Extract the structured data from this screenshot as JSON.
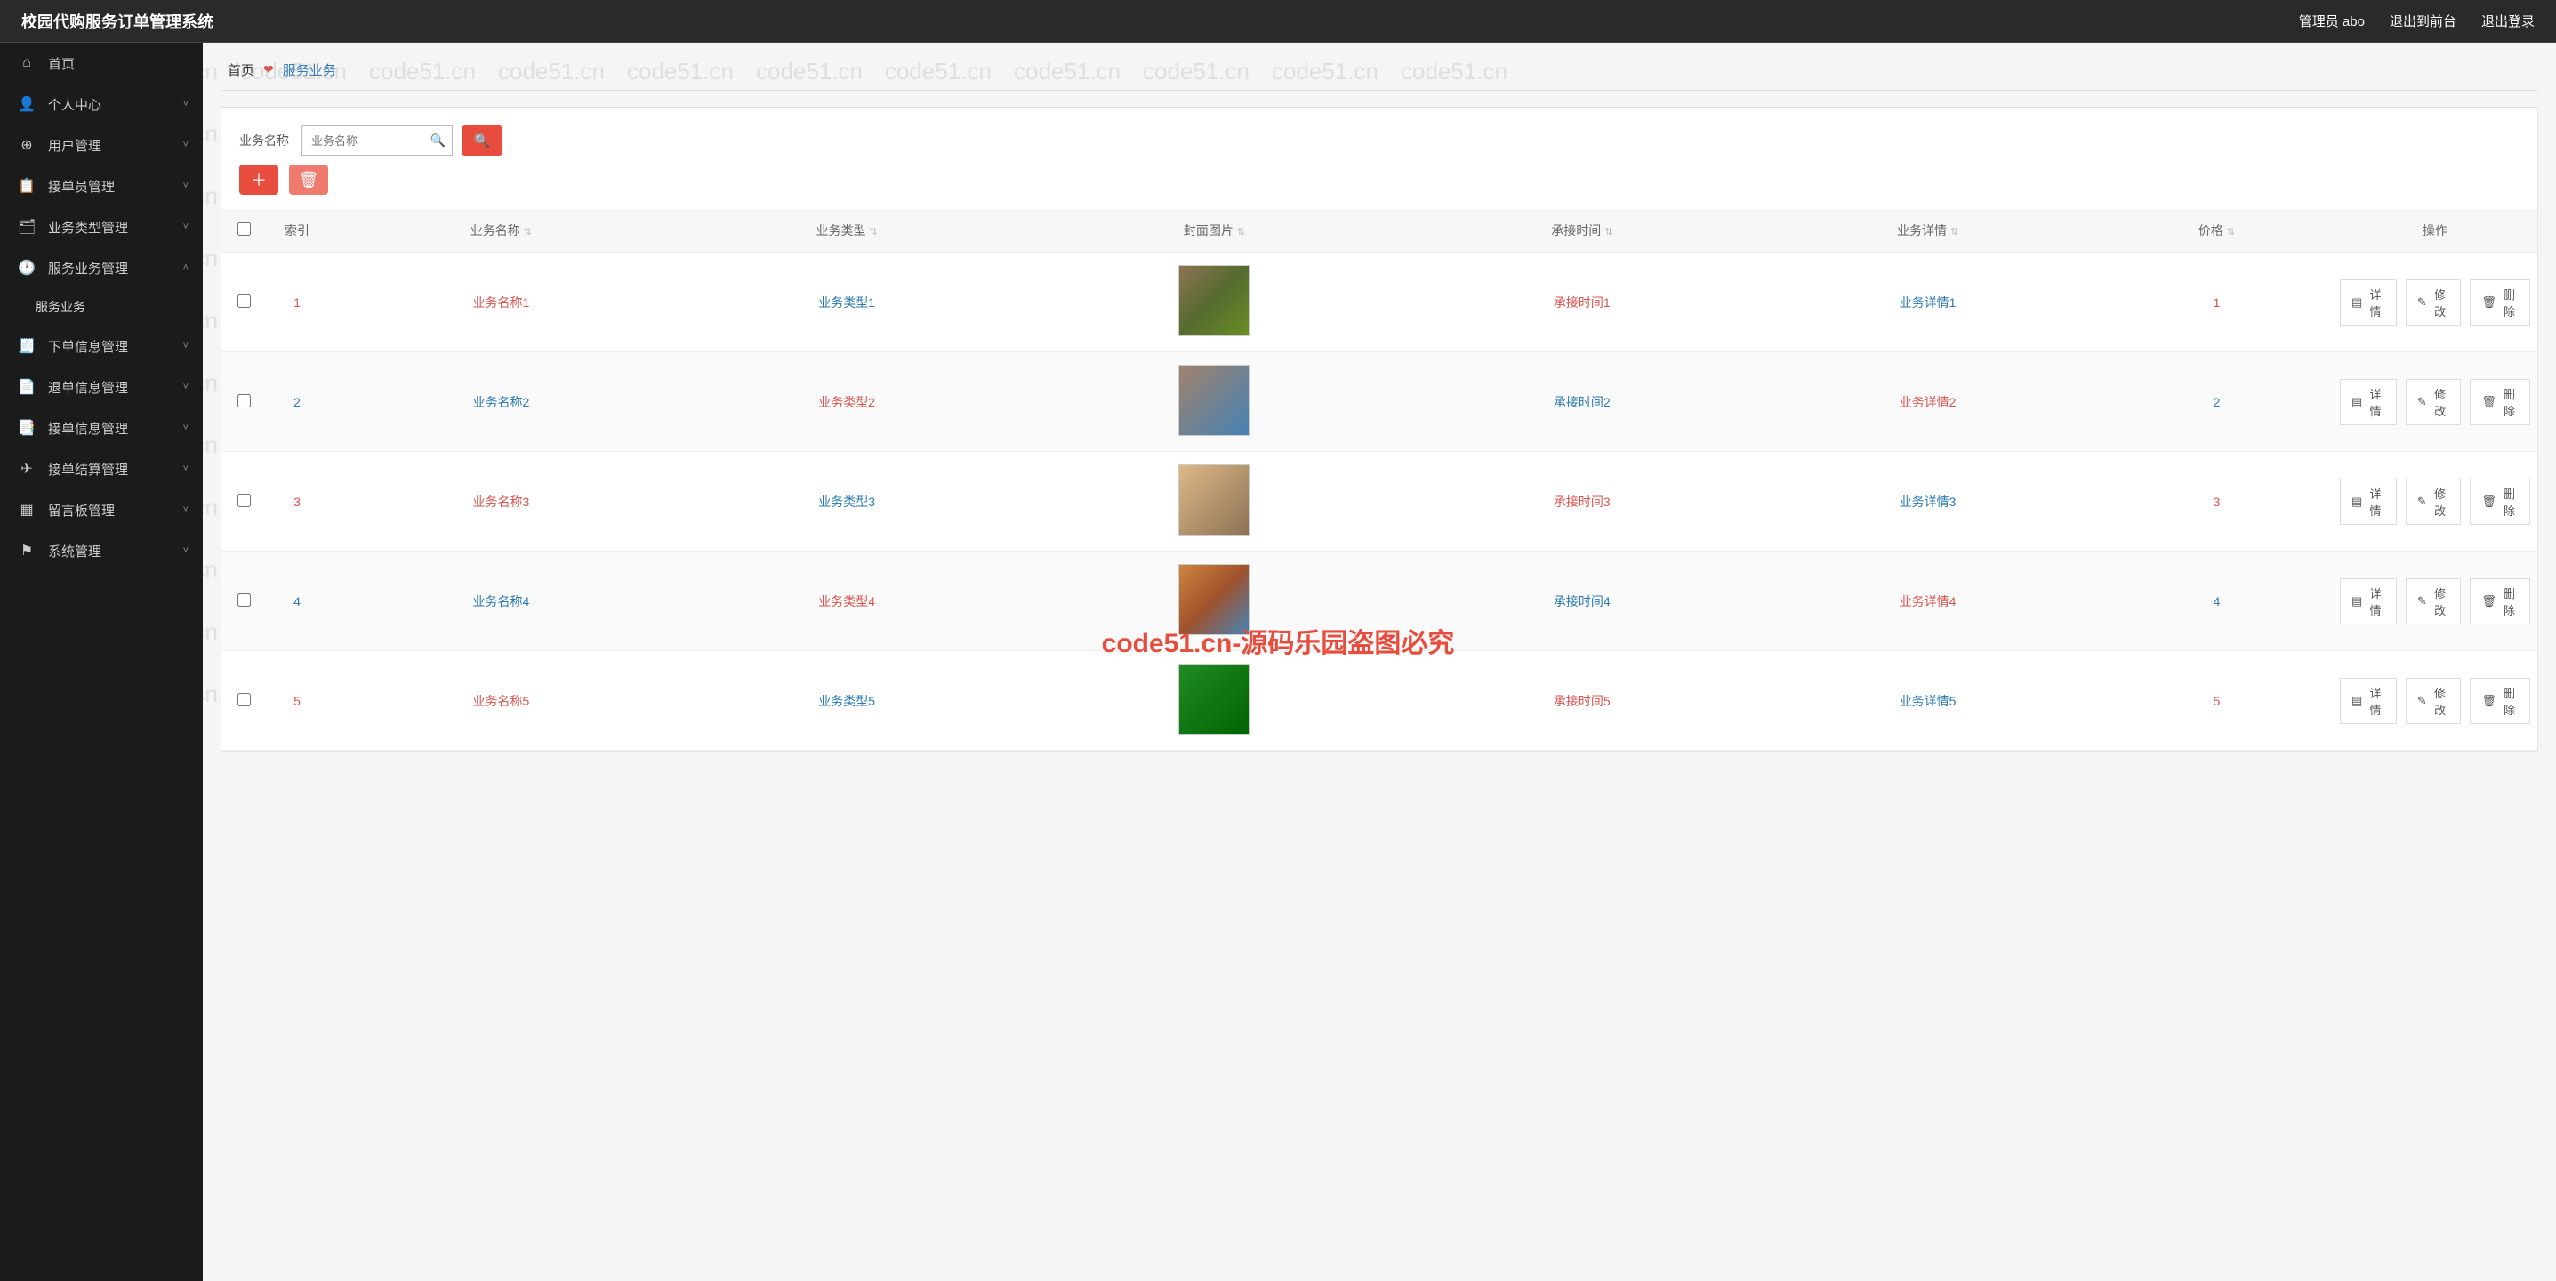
{
  "header": {
    "systemTitle": "校园代购服务订单管理系统",
    "adminLabel": "管理员 abo",
    "exitFront": "退出到前台",
    "logout": "退出登录"
  },
  "sidebar": {
    "home": "首页",
    "items": [
      {
        "label": "个人中心",
        "icon": "user-icon",
        "glyph": "👤"
      },
      {
        "label": "用户管理",
        "icon": "target-icon",
        "glyph": "⊕"
      },
      {
        "label": "接单员管理",
        "icon": "clipboard-icon",
        "glyph": "📋"
      },
      {
        "label": "业务类型管理",
        "icon": "category-icon",
        "glyph": "🗂"
      },
      {
        "label": "服务业务管理",
        "icon": "clock-icon",
        "glyph": "🕐",
        "expanded": true,
        "children": [
          {
            "label": "服务业务"
          }
        ]
      },
      {
        "label": "下单信息管理",
        "icon": "order-icon",
        "glyph": "🧾"
      },
      {
        "label": "退单信息管理",
        "icon": "refund-icon",
        "glyph": "📄"
      },
      {
        "label": "接单信息管理",
        "icon": "accept-icon",
        "glyph": "📑"
      },
      {
        "label": "接单结算管理",
        "icon": "settle-icon",
        "glyph": "✈"
      },
      {
        "label": "留言板管理",
        "icon": "board-icon",
        "glyph": "▦"
      },
      {
        "label": "系统管理",
        "icon": "flag-icon",
        "glyph": "⚑"
      }
    ]
  },
  "breadcrumb": {
    "home": "首页",
    "current": "服务业务"
  },
  "search": {
    "label": "业务名称",
    "placeholder": "业务名称"
  },
  "table": {
    "headers": {
      "index": "索引",
      "name": "业务名称",
      "type": "业务类型",
      "cover": "封面图片",
      "acceptTime": "承接时间",
      "detail": "业务详情",
      "price": "价格",
      "ops": "操作"
    },
    "ops": {
      "detail": "详情",
      "edit": "修改",
      "delete": "删除"
    },
    "rows": [
      {
        "idx": "1",
        "name": "业务名称1",
        "type": "业务类型1",
        "time": "承接时间1",
        "detail": "业务详情1",
        "price": "1",
        "thumb": "t1"
      },
      {
        "idx": "2",
        "name": "业务名称2",
        "type": "业务类型2",
        "time": "承接时间2",
        "detail": "业务详情2",
        "price": "2",
        "thumb": "t2"
      },
      {
        "idx": "3",
        "name": "业务名称3",
        "type": "业务类型3",
        "time": "承接时间3",
        "detail": "业务详情3",
        "price": "3",
        "thumb": "t3"
      },
      {
        "idx": "4",
        "name": "业务名称4",
        "type": "业务类型4",
        "time": "承接时间4",
        "detail": "业务详情4",
        "price": "4",
        "thumb": "t4"
      },
      {
        "idx": "5",
        "name": "业务名称5",
        "type": "业务类型5",
        "time": "承接时间5",
        "detail": "业务详情5",
        "price": "5",
        "thumb": "t5"
      }
    ]
  },
  "watermark": {
    "small": "code51.cn",
    "big": "code51.cn-源码乐园盗图必究"
  }
}
